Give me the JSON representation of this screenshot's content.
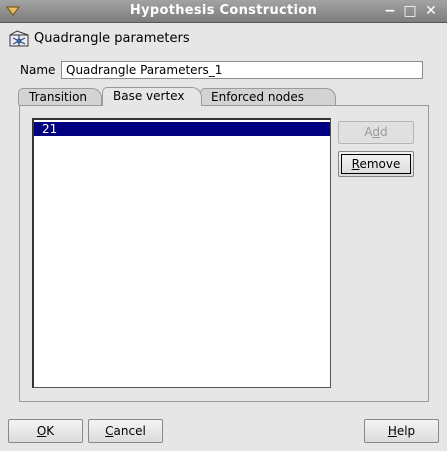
{
  "window": {
    "title": "Hypothesis Construction",
    "minimize_glyph": "−",
    "maximize_glyph": "□",
    "close_glyph": "✕"
  },
  "header": {
    "icon": "mesh-hypothesis-icon",
    "title": "Quadrangle parameters"
  },
  "name_field": {
    "label": "Name",
    "value": "Quadrangle Parameters_1"
  },
  "tabs": [
    {
      "label": "Transition",
      "active": false
    },
    {
      "label": "Base vertex",
      "active": true
    },
    {
      "label": "Enforced nodes",
      "active": false
    }
  ],
  "vertex_list": {
    "items": [
      {
        "label": "21",
        "selected": true
      }
    ]
  },
  "side_buttons": {
    "add_label": "Add",
    "add_mnemonic": "d",
    "remove_label": "Remove",
    "remove_mnemonic": "R"
  },
  "footer": {
    "ok_label": "OK",
    "cancel_label": "Cancel",
    "help_label": "Help"
  },
  "colors": {
    "selection": "#000080",
    "titlebar": "#8c8c8c"
  }
}
